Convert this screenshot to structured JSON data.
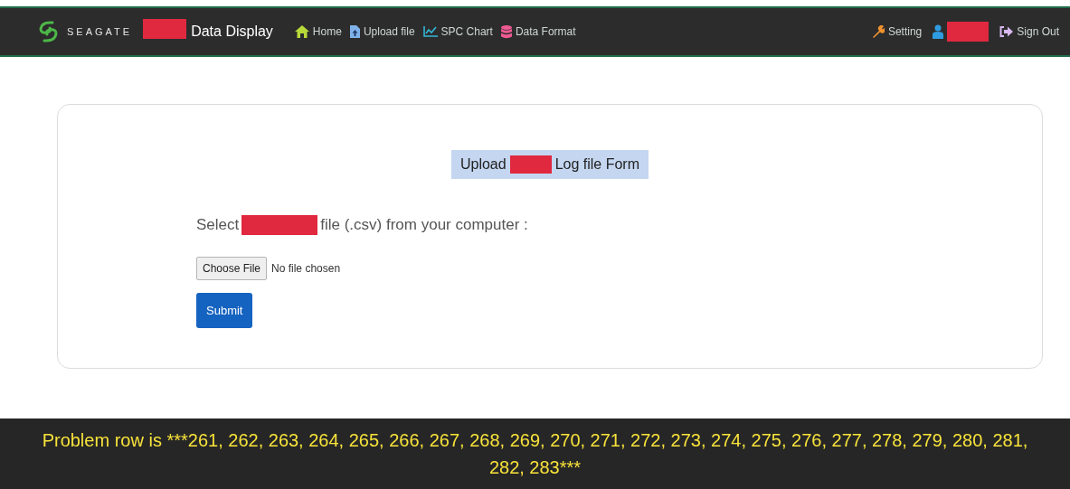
{
  "navbar": {
    "logo_text": "SEAGATE",
    "brand": "Data Display",
    "links": [
      {
        "kind": "home",
        "label": "Home"
      },
      {
        "kind": "upload",
        "label": "Upload file"
      },
      {
        "kind": "chart",
        "label": "SPC Chart"
      },
      {
        "kind": "database",
        "label": "Data Format"
      }
    ],
    "right_links": [
      {
        "kind": "setting",
        "label": "Setting"
      },
      {
        "kind": "user"
      },
      {
        "kind": "signout",
        "label": "Sign Out"
      }
    ]
  },
  "form": {
    "title_before": "Upload",
    "title_after": "Log file Form",
    "prompt_before": "Select",
    "prompt_after": "file (.csv) from your computer :",
    "file_button": "Choose File",
    "file_status": "No file chosen",
    "submit": "Submit"
  },
  "message": "Problem row is ***261, 262, 263, 264, 265, 266, 267, 268, 269, 270, 271, 272, 273, 274, 275, 276, 277, 278, 279, 280, 281, 282, 283***"
}
